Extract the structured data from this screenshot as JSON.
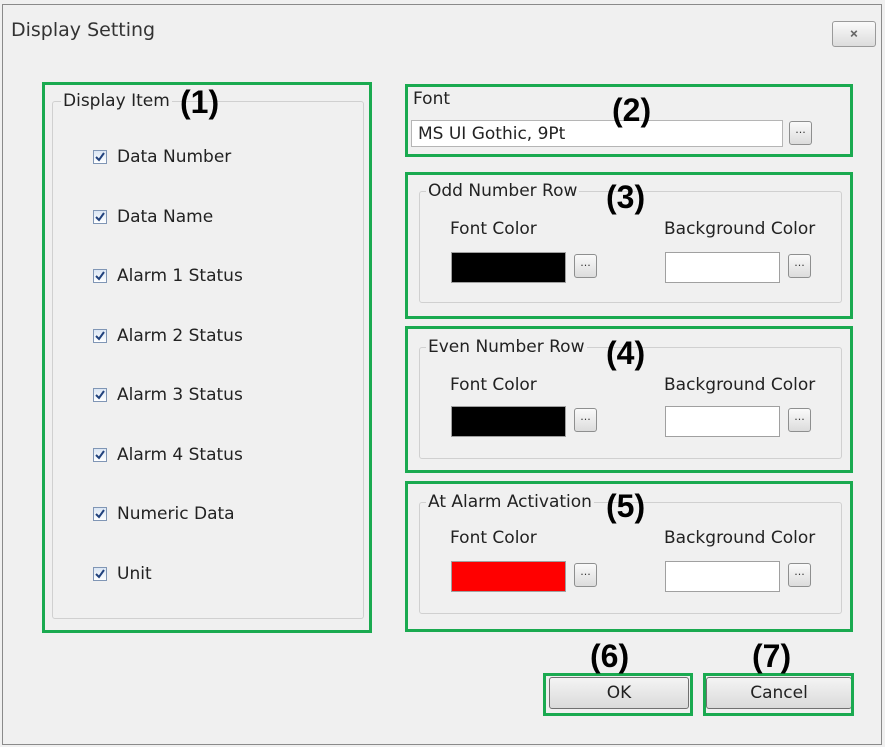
{
  "window": {
    "title": "Display Setting",
    "close_glyph": "⨯"
  },
  "display_item": {
    "legend": "Display Item",
    "items": [
      {
        "label": "Data Number",
        "checked": true
      },
      {
        "label": "Data Name",
        "checked": true
      },
      {
        "label": "Alarm 1 Status",
        "checked": true
      },
      {
        "label": "Alarm 2 Status",
        "checked": true
      },
      {
        "label": "Alarm 3 Status",
        "checked": true
      },
      {
        "label": "Alarm 4 Status",
        "checked": true
      },
      {
        "label": "Numeric Data",
        "checked": true
      },
      {
        "label": "Unit",
        "checked": true
      }
    ]
  },
  "font": {
    "legend": "Font",
    "value": "MS UI Gothic, 9Pt",
    "browse_label": "..."
  },
  "odd_row": {
    "legend": "Odd Number Row",
    "font_color_label": "Font Color",
    "font_color": "#000000",
    "background_color_label": "Background Color",
    "background_color": "#ffffff",
    "browse_label": "..."
  },
  "even_row": {
    "legend": "Even Number Row",
    "font_color_label": "Font Color",
    "font_color": "#000000",
    "background_color_label": "Background Color",
    "background_color": "#ffffff",
    "browse_label": "..."
  },
  "alarm": {
    "legend": "At Alarm Activation",
    "font_color_label": "Font Color",
    "font_color": "#ff0000",
    "background_color_label": "Background Color",
    "background_color": "#ffffff",
    "browse_label": "..."
  },
  "buttons": {
    "ok": "OK",
    "cancel": "Cancel"
  },
  "callouts": [
    "(1)",
    "(2)",
    "(3)",
    "(4)",
    "(5)",
    "(6)",
    "(7)"
  ],
  "accent_color": "#1aaa50"
}
